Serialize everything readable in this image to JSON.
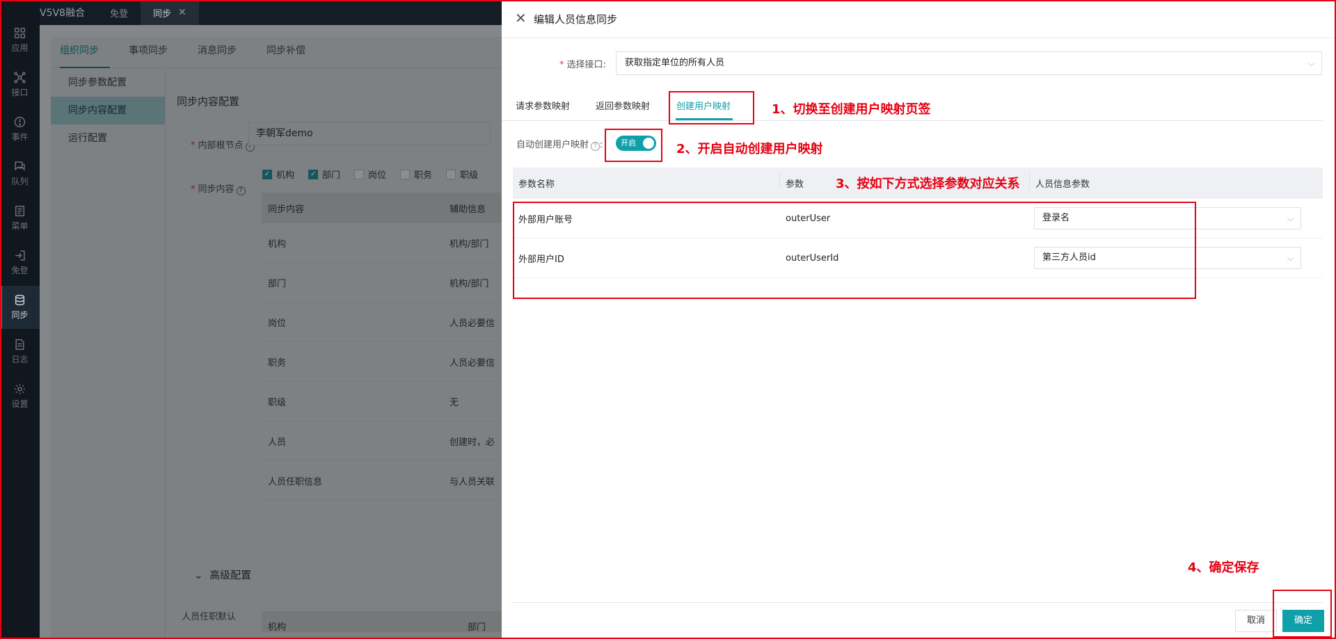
{
  "rail": [
    {
      "label": "应用",
      "icon": "grid-icon"
    },
    {
      "label": "接口",
      "icon": "network-icon"
    },
    {
      "label": "事件",
      "icon": "alert-icon"
    },
    {
      "label": "队列",
      "icon": "chat-icon"
    },
    {
      "label": "菜单",
      "icon": "document-icon"
    },
    {
      "label": "免登",
      "icon": "login-icon"
    },
    {
      "label": "同步",
      "icon": "database-icon"
    },
    {
      "label": "日志",
      "icon": "file-icon"
    },
    {
      "label": "设置",
      "icon": "gear-icon"
    }
  ],
  "topbar": {
    "app_title": "V5V8融合",
    "tabs": [
      {
        "label": "免登"
      },
      {
        "label": "同步",
        "close": "✕"
      }
    ]
  },
  "bg": {
    "tabs": [
      "组织同步",
      "事项同步",
      "消息同步",
      "同步补偿"
    ],
    "side": [
      "同步参数配置",
      "同步内容配置",
      "运行配置"
    ],
    "section_title": "同步内容配置",
    "root_label": "内部根节点",
    "root_value": "李朝军demo",
    "content_label": "同步内容",
    "checkboxes": [
      {
        "label": "机构",
        "checked": true
      },
      {
        "label": "部门",
        "checked": true
      },
      {
        "label": "岗位",
        "checked": false
      },
      {
        "label": "职务",
        "checked": false
      },
      {
        "label": "职级",
        "checked": false
      }
    ],
    "table_headers": [
      "同步内容",
      "辅助信息"
    ],
    "rows": [
      {
        "name": "机构",
        "info": "机构/部门"
      },
      {
        "name": "部门",
        "info": "机构/部门"
      },
      {
        "name": "岗位",
        "info": "人员必要信"
      },
      {
        "name": "职务",
        "info": "人员必要信"
      },
      {
        "name": "职级",
        "info": "无"
      },
      {
        "name": "人员",
        "info": "创建时，必"
      },
      {
        "name": "人员任职信息",
        "info": "与人员关联"
      }
    ],
    "advanced": "高级配置",
    "advanced_label": "人员任职默认",
    "advanced_headers": [
      "机构",
      "部门"
    ]
  },
  "drawer": {
    "title": "编辑人员信息同步",
    "api_label": "选择接口:",
    "api_value": "获取指定单位的所有人员",
    "tabs": [
      "请求参数映射",
      "返回参数映射",
      "创建用户映射"
    ],
    "auto_label": "自动创建用户映射",
    "toggle_label": "开启",
    "headers": [
      "参数名称",
      "参数",
      "人员信息参数"
    ],
    "rows": [
      {
        "name": "外部用户账号",
        "param": "outerUser",
        "mapped": "登录名"
      },
      {
        "name": "外部用户ID",
        "param": "outerUserId",
        "mapped": "第三方人员id"
      }
    ],
    "cancel": "取消",
    "ok": "确定"
  },
  "notes": {
    "n1": "1、切换至创建用户映射页签",
    "n2": "2、开启自动创建用户映射",
    "n3": "3、按如下方式选择参数对应关系",
    "n4": "4、确定保存"
  },
  "colors": {
    "accent": "#10a0aa",
    "annotation": "#e60012",
    "rail": "#10171e"
  }
}
